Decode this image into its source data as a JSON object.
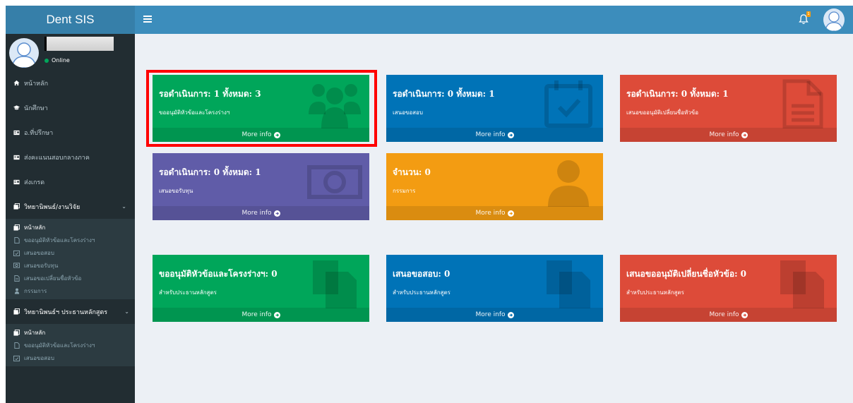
{
  "app": {
    "logo": "Dent SIS"
  },
  "user_panel": {
    "status": "Online"
  },
  "sidebar": {
    "items": [
      {
        "label": "หน้าหลัก",
        "icon": "home-icon"
      },
      {
        "label": "นักศึกษา",
        "icon": "graduation-cap-icon"
      },
      {
        "label": "อ.ที่ปรึกษา",
        "icon": "id-card-icon"
      },
      {
        "label": "ส่งคะแนนสอบกลางภาค",
        "icon": "id-card-icon"
      },
      {
        "label": "ส่งเกรด",
        "icon": "id-card-icon"
      }
    ],
    "group1": {
      "label": "วิทยานิพนธ์/งานวิจัย",
      "items": [
        {
          "label": "หน้าหลัก",
          "icon": "clone-icon"
        },
        {
          "label": "ขออนุมัติหัวข้อและโครงร่างฯ",
          "icon": "file-icon"
        },
        {
          "label": "เสนอขอสอบ",
          "icon": "calendar-check-icon"
        },
        {
          "label": "เสนอขอรับทุน",
          "icon": "money-icon"
        },
        {
          "label": "เสนอขอเปลี่ยนชื่อหัวข้อ",
          "icon": "file-text-icon"
        },
        {
          "label": "กรรมการ",
          "icon": "user-icon"
        }
      ]
    },
    "group2": {
      "label": "วิทยานิพนธ์ฯ ประธานหลักสูตร",
      "items": [
        {
          "label": "หน้าหลัก",
          "icon": "clone-icon"
        },
        {
          "label": "ขออนุมัติหัวข้อและโครงร่างฯ",
          "icon": "file-icon"
        },
        {
          "label": "เสนอขอสอบ",
          "icon": "calendar-check-icon"
        }
      ]
    }
  },
  "header": {
    "notification_count": "1"
  },
  "boxes": [
    {
      "title": "รอดำเนินการ: 1 ทั้งหมด: 3",
      "subtitle": "ขออนุมัติหัวข้อและโครงร่างฯ",
      "footer": "More info",
      "color": "#00a65a",
      "icon": "users-icon"
    },
    {
      "title": "รอดำเนินการ: 0 ทั้งหมด: 1",
      "subtitle": "เสนอขอสอบ",
      "footer": "More info",
      "color": "#0073b7",
      "icon": "calendar-check-icon"
    },
    {
      "title": "รอดำเนินการ: 0 ทั้งหมด: 1",
      "subtitle": "เสนอขออนุมัติเปลี่ยนชื่อหัวข้อ",
      "footer": "More info",
      "color": "#dd4b39",
      "icon": "file-text-icon"
    },
    {
      "title": "รอดำเนินการ: 0 ทั้งหมด: 1",
      "subtitle": "เสนอขอรับทุน",
      "footer": "More info",
      "color": "#605ca8",
      "icon": "money-icon"
    },
    {
      "title": "จำนวน: 0",
      "subtitle": "กรรมการ",
      "footer": "More info",
      "color": "#f39c12",
      "icon": "user-icon"
    },
    {
      "title": "ขออนุมัติหัวข้อและโครงร่างฯ: 0",
      "subtitle": "สำหรับประธานหลักสูตร",
      "footer": "More info",
      "color": "#00a65a",
      "icon": "copy-icon"
    },
    {
      "title": "เสนอขอสอบ: 0",
      "subtitle": "สำหรับประธานหลักสูตร",
      "footer": "More info",
      "color": "#0073b7",
      "icon": "copy-icon"
    },
    {
      "title": "เสนอขออนุมัติเปลี่ยนชื่อหัวข้อ: 0",
      "subtitle": "สำหรับประธานหลักสูตร",
      "footer": "More info",
      "color": "#dd4b39",
      "icon": "copy-icon"
    }
  ]
}
